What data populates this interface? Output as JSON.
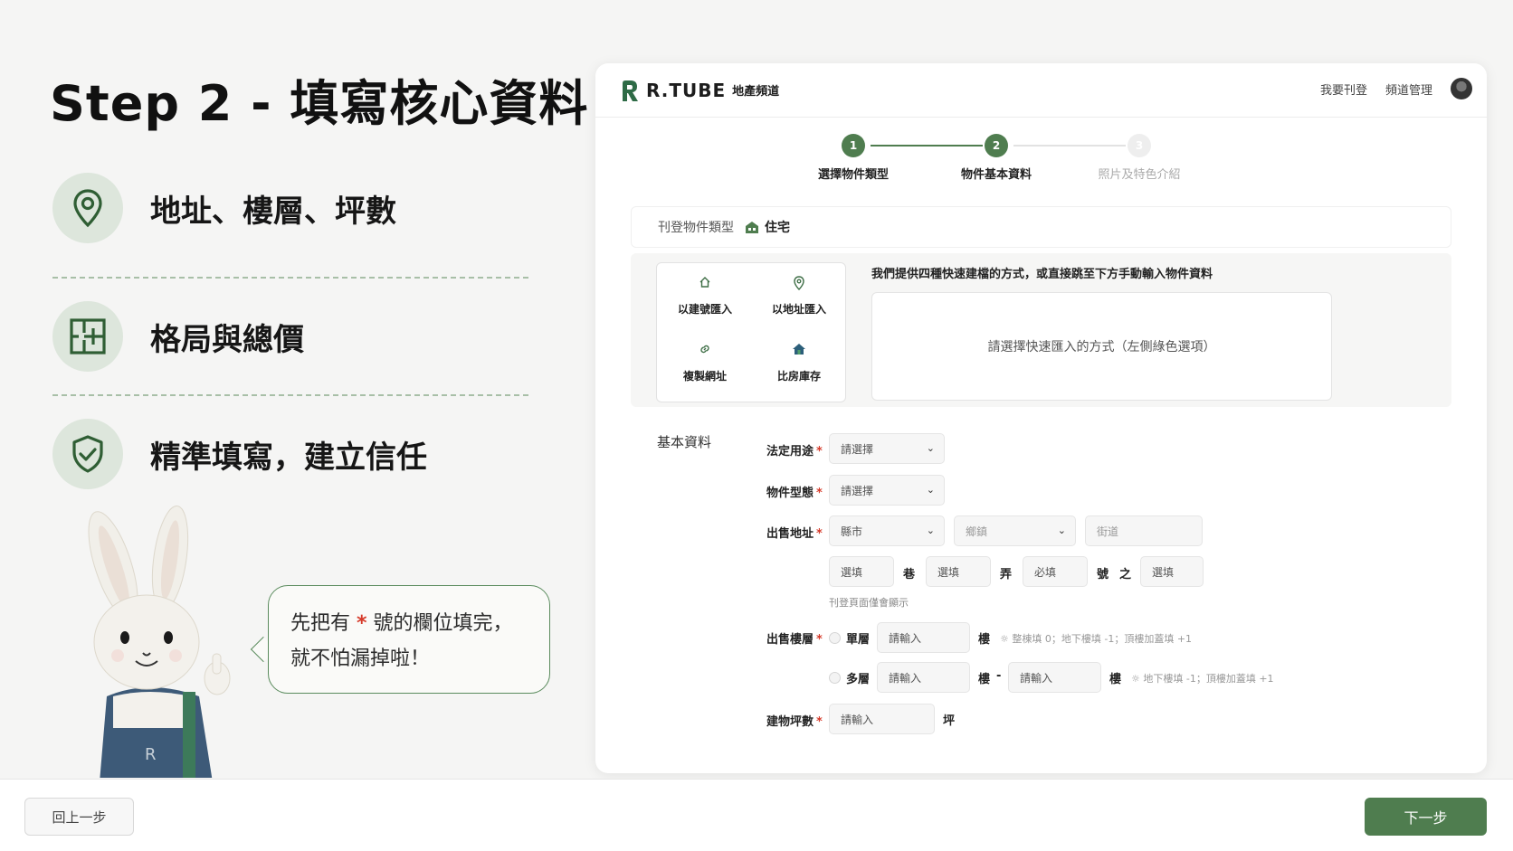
{
  "slide": {
    "title": "Step 2 - 填寫核心資料",
    "features": [
      {
        "icon": "map-pin-icon",
        "label": "地址、樓層、坪數"
      },
      {
        "icon": "floor-plan-icon",
        "label": "格局與總價"
      },
      {
        "icon": "shield-check-icon",
        "label": "精準填寫，建立信任"
      }
    ],
    "bubble": {
      "line1_before": "先把有 ",
      "star": "*",
      "line1_after": " 號的欄位填完，",
      "line2": "就不怕漏掉啦！"
    }
  },
  "app": {
    "brand": "R.TUBE",
    "brand_sub": "地產頻道",
    "nav": {
      "post": "我要刊登",
      "channel": "頻道管理"
    },
    "stepper": [
      {
        "num": "1",
        "label": "選擇物件類型",
        "state": "done"
      },
      {
        "num": "2",
        "label": "物件基本資料",
        "state": "active"
      },
      {
        "num": "3",
        "label": "照片及特色介紹",
        "state": "pending"
      }
    ],
    "type_section": {
      "label": "刊登物件類型",
      "value": "住宅"
    },
    "quick": {
      "items": [
        {
          "icon": "home-icon",
          "label": "以建號匯入"
        },
        {
          "icon": "location-icon",
          "label": "以地址匯入"
        },
        {
          "icon": "link-icon",
          "label": "複製網址"
        },
        {
          "icon": "house-stock-icon",
          "label": "比房庫存"
        }
      ],
      "note": "我們提供四種快速建檔的方式，或直接跳至下方手動輸入物件資料",
      "placeholder": "請選擇快速匯入的方式（左側綠色選項）"
    },
    "basic": {
      "title": "基本資料",
      "legal_use": {
        "label": "法定用途",
        "value": "請選擇"
      },
      "property_type": {
        "label": "物件型態",
        "value": "請選擇"
      },
      "address": {
        "label": "出售地址",
        "city": "縣市",
        "district": "鄉鎮",
        "street": "街道",
        "lane": "選填",
        "lane_unit": "巷",
        "alley": "選填",
        "alley_unit": "弄",
        "number": "必填",
        "number_unit": "號",
        "of": "之",
        "sub": "選填",
        "note": "刊登頁面僅會顯示"
      },
      "floor": {
        "label": "出售樓層",
        "single": "單層",
        "single_ph": "請輸入",
        "unit": "樓",
        "single_hint": "整棟填 0；地下樓填 -1；頂樓加蓋填 +1",
        "multi": "多層",
        "multi_from": "請輸入",
        "dash": "-",
        "multi_to": "請輸入",
        "multi_hint": "地下樓填 -1；頂樓加蓋填 +1"
      },
      "area": {
        "label": "建物坪數",
        "ph": "請輸入",
        "unit": "坪"
      },
      "required_mark": "*"
    }
  },
  "footer": {
    "back": "回上一步",
    "next": "下一步"
  },
  "colors": {
    "accent": "#4f7d4f",
    "accent_light": "#dde6dc",
    "required": "#d63a2a"
  }
}
